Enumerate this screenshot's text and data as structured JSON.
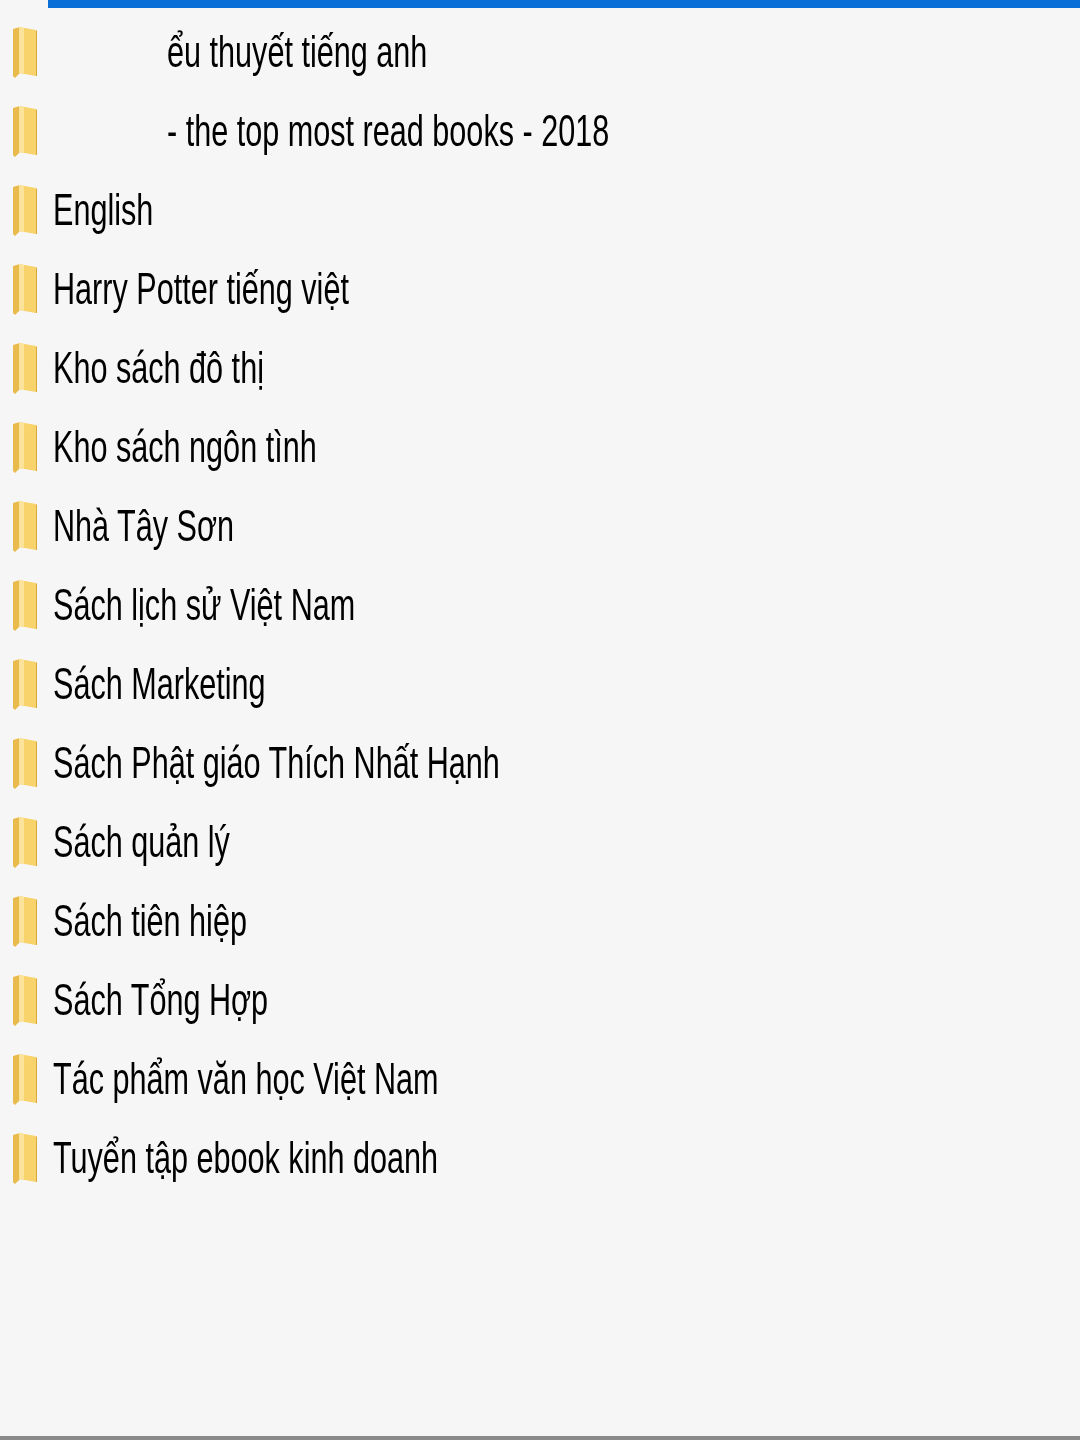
{
  "folders": [
    {
      "kind": "partial",
      "name": "ểu thuyết tiếng anh"
    },
    {
      "kind": "partial",
      "name": "- the top most read books - 2018"
    },
    {
      "kind": "folder",
      "name": "English"
    },
    {
      "kind": "folder",
      "name": "Harry Potter tiếng việt"
    },
    {
      "kind": "folder",
      "name": "Kho sách đô thị"
    },
    {
      "kind": "folder",
      "name": "Kho sách ngôn tình"
    },
    {
      "kind": "folder",
      "name": "Nhà Tây Sơn"
    },
    {
      "kind": "folder",
      "name": "Sách lịch sử Việt Nam"
    },
    {
      "kind": "folder",
      "name": "Sách Marketing"
    },
    {
      "kind": "folder",
      "name": "Sách Phật giáo Thích Nhất Hạnh"
    },
    {
      "kind": "folder",
      "name": "Sách quản lý"
    },
    {
      "kind": "folder",
      "name": "Sách tiên hiệp"
    },
    {
      "kind": "folder",
      "name": "Sách Tổng Hợp"
    },
    {
      "kind": "folder",
      "name": "Tác phẩm văn học Việt Nam"
    },
    {
      "kind": "folder",
      "name": "Tuyển tập ebook kinh doanh"
    }
  ]
}
